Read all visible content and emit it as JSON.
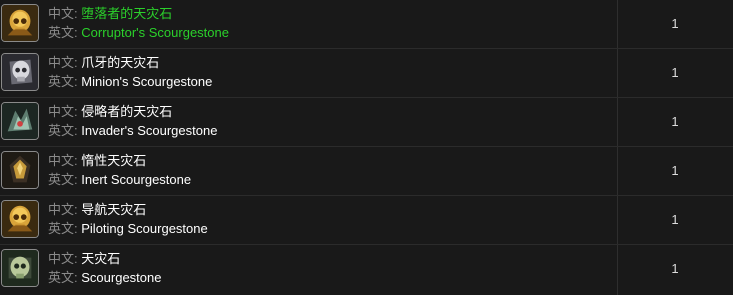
{
  "rows": [
    {
      "cn_prefix": "中文:",
      "cn_name": "堕落者的天灾石",
      "en_prefix": "英文:",
      "en_name": "Corruptor's Scourgestone",
      "qty": "1",
      "name_color": "#2bd12b",
      "icon": "golden-skull-icon"
    },
    {
      "cn_prefix": "中文:",
      "cn_name": "爪牙的天灾石",
      "en_prefix": "英文:",
      "en_name": "Minion's Scourgestone",
      "qty": "1",
      "name_color": "#ffffff",
      "icon": "silver-skull-icon"
    },
    {
      "cn_prefix": "中文:",
      "cn_name": "侵略者的天灾石",
      "en_prefix": "英文:",
      "en_name": "Invader's Scourgestone",
      "qty": "1",
      "name_color": "#ffffff",
      "icon": "green-crystal-icon"
    },
    {
      "cn_prefix": "中文:",
      "cn_name": "惰性天灾石",
      "en_prefix": "英文:",
      "en_name": "Inert Scourgestone",
      "qty": "1",
      "name_color": "#ffffff",
      "icon": "dark-gem-icon"
    },
    {
      "cn_prefix": "中文:",
      "cn_name": "导航天灾石",
      "en_prefix": "英文:",
      "en_name": "Piloting Scourgestone",
      "qty": "1",
      "name_color": "#ffffff",
      "icon": "golden-skull-icon"
    },
    {
      "cn_prefix": "中文:",
      "cn_name": "天灾石",
      "en_prefix": "英文:",
      "en_name": "Scourgestone",
      "qty": "1",
      "name_color": "#ffffff",
      "icon": "green-skull-icon"
    }
  ]
}
